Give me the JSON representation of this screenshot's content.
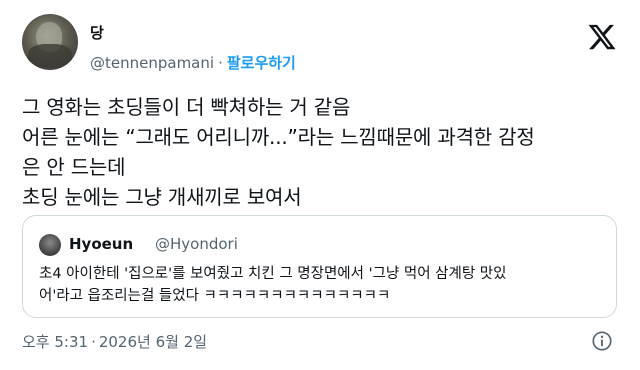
{
  "author": {
    "name": "당",
    "handle": "@tennenpamani",
    "separator": "·",
    "follow_label": "팔로우하기"
  },
  "icons": {
    "logo": "x-logo-icon",
    "info": "info-icon"
  },
  "body_lines": [
    "그 영화는 초딩들이 더 빡쳐하는 거 같음",
    "어른 눈에는 “그래도 어리니까...”라는 느낌때문에 과격한 감정",
    "은 안 드는데",
    "초딩 눈에는 그냥 개새끼로 보여서"
  ],
  "quoted": {
    "name": "Hyoeun",
    "handle": "@Hyondori",
    "text_lines": [
      "초4 아이한테 '집으로'를 보여줬고 치킨 그 명장면에서 '그냥 먹어 삼계탕 맛있",
      "어'라고 읍조리는걸 들었다 ㅋㅋㅋㅋㅋㅋㅋㅋㅋㅋㅋㅋㅋㅋ"
    ]
  },
  "meta": {
    "time": "오후 5:31",
    "separator": "·",
    "date": "2026년 6월 2일"
  },
  "colors": {
    "text": "#0f1419",
    "secondary": "#536471",
    "accent": "#1d9bf0",
    "border": "#cfd9de"
  }
}
